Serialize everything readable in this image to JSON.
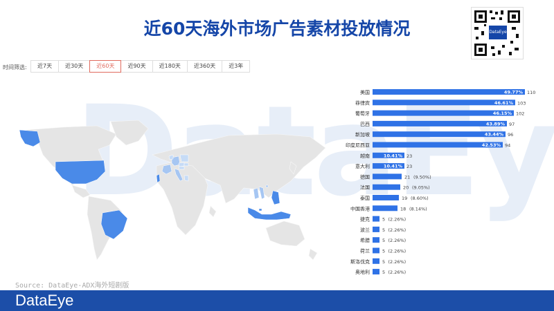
{
  "title": "近60天海外市场广告素材投放情况",
  "qr_label": "DataEye",
  "filter_label": "时间筛选:",
  "filters": [
    "近7天",
    "近30天",
    "近60天",
    "近90天",
    "近180天",
    "近360天",
    "近3年"
  ],
  "active_filter": 2,
  "watermark": "DataEye",
  "source": "Source: DataEye-ADX海外短剧版",
  "brand": "DataEye",
  "colors": {
    "accent": "#2f72e6",
    "active": "#e06a5d",
    "footer": "#1c4ea8",
    "map_base": "#e5e5e5"
  },
  "chart_data": {
    "type": "bar",
    "orientation": "horizontal",
    "categories": [
      "美国",
      "菲律宾",
      "葡萄牙",
      "巴西",
      "新加坡",
      "印度尼西亚",
      "越南",
      "意大利",
      "德国",
      "法国",
      "泰国",
      "中国香港",
      "捷克",
      "波兰",
      "希腊",
      "荷兰",
      "斯洛伐克",
      "奥地利"
    ],
    "values": [
      110,
      103,
      102,
      97,
      96,
      94,
      23,
      23,
      21,
      20,
      19,
      18,
      5,
      5,
      5,
      5,
      5,
      5
    ],
    "shares": [
      "49.77%",
      "46.61%",
      "46.15%",
      "43.89%",
      "43.44%",
      "42.53%",
      "10.41%",
      "10.41%",
      "9.50%",
      "9.05%",
      "8.60%",
      "8.14%",
      "2.26%",
      "2.26%",
      "2.26%",
      "2.26%",
      "2.26%",
      "2.26%"
    ],
    "value_labels": [
      "110",
      "103",
      "102",
      "97",
      "96",
      "94",
      "23",
      "23",
      "21",
      "20",
      "19",
      "18",
      "5",
      "5",
      "5",
      "5",
      "5",
      "5"
    ],
    "share_labels": [
      "49.77%",
      "46.61%",
      "46.15%",
      "43.89%",
      "43.44%",
      "42.53%",
      "10.41%",
      "10.41%",
      "(9.50%)",
      "(9.05%)",
      "(8.60%)",
      "(8.14%)",
      "(2.26%)",
      "(2.26%)",
      "(2.26%)",
      "(2.26%)",
      "(2.26%)",
      "(2.26%)"
    ],
    "xlim": [
      0,
      110
    ],
    "map_highlight_intensity": {
      "usa": 110,
      "philippines": 103,
      "portugal": 102,
      "brazil": 97,
      "singapore": 96,
      "indonesia": 94,
      "vietnam": 23,
      "italy": 23,
      "germany": 21,
      "france": 20,
      "thailand": 19,
      "hongkong": 18,
      "czech": 5,
      "poland": 5,
      "greece": 5,
      "netherlands": 5,
      "slovakia": 5,
      "austria": 5,
      "alaska": 110
    }
  }
}
